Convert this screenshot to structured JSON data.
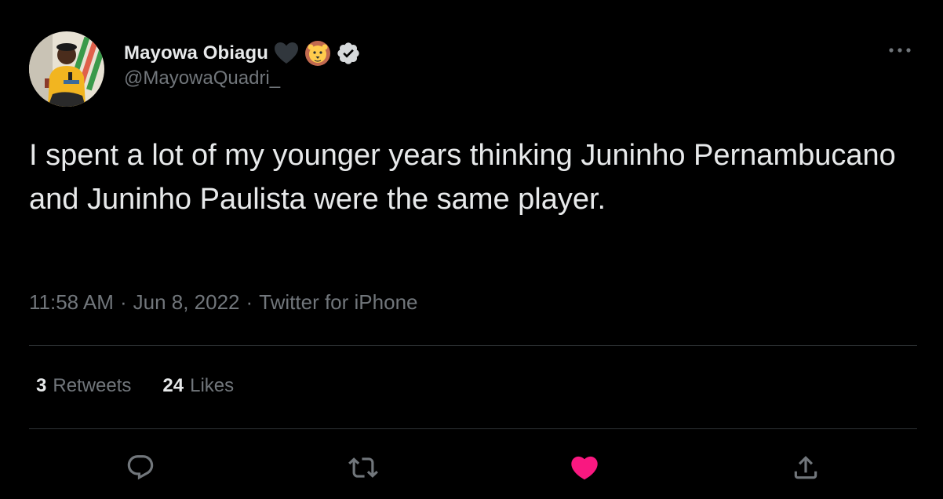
{
  "user": {
    "display_name": "Mayowa Obiagu",
    "handle": "@MayowaQuadri_",
    "name_emojis": [
      "black-heart-emoji",
      "lion-emoji"
    ],
    "verified": true,
    "avatar": "profile-photo"
  },
  "tweet": {
    "text": "I spent a lot of my younger years thinking Juninho Pernambucano and Juninho Paulista were the same player.",
    "time": "11:58 AM",
    "date": "Jun 8, 2022",
    "source": "Twitter for iPhone",
    "separator": "·"
  },
  "stats": {
    "retweets_count": "3",
    "retweets_label": "Retweets",
    "likes_count": "24",
    "likes_label": "Likes"
  },
  "actions": [
    {
      "icon": "reply-icon"
    },
    {
      "icon": "retweet-icon"
    },
    {
      "icon": "like-icon",
      "liked": true
    },
    {
      "icon": "share-icon"
    }
  ],
  "colors": {
    "background": "#000000",
    "text_primary": "#e7e9ea",
    "text_secondary": "#71767b",
    "divider": "#2f3336",
    "like_active": "#f91880"
  }
}
